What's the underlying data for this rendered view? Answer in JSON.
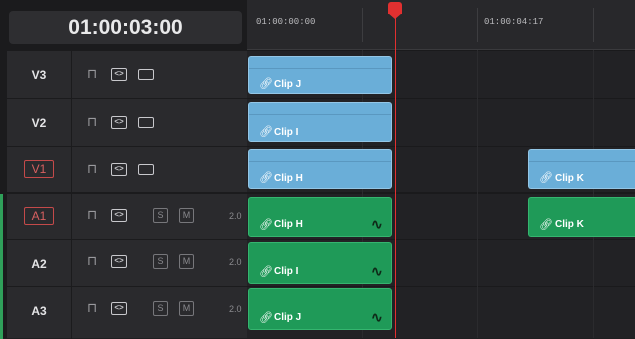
{
  "timecode": "01:00:03:00",
  "ruler": {
    "labels": [
      "01:00:00:00",
      "01:00:04:17"
    ]
  },
  "tracks": [
    {
      "name": "V3",
      "type": "video",
      "target": false
    },
    {
      "name": "V2",
      "type": "video",
      "target": false
    },
    {
      "name": "V1",
      "type": "video",
      "target": true
    },
    {
      "name": "A1",
      "type": "audio",
      "target": true,
      "channels": "2.0"
    },
    {
      "name": "A2",
      "type": "audio",
      "target": false,
      "channels": "2.0"
    },
    {
      "name": "A3",
      "type": "audio",
      "target": false,
      "channels": "2.0"
    }
  ],
  "buttons": {
    "solo": "S",
    "mute": "M"
  },
  "clips": {
    "v3": "Clip J",
    "v2": "Clip I",
    "v1_a": "Clip H",
    "v1_b": "Clip K",
    "a1_a": "Clip H",
    "a1_b": "Clip K",
    "a2": "Clip I",
    "a3": "Clip J"
  },
  "colors": {
    "video_clip": "#6aaed8",
    "audio_clip": "#1f9a58",
    "playhead": "#e23030"
  }
}
